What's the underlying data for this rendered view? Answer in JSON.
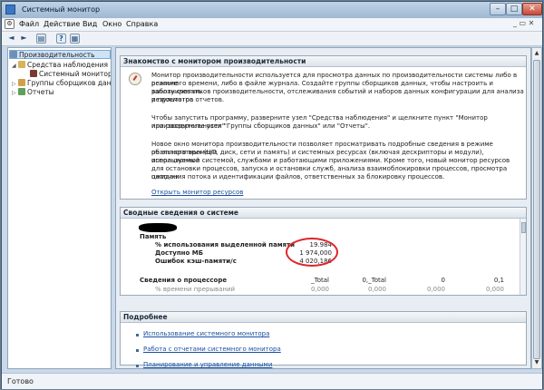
{
  "window": {
    "title": "Системный монитор"
  },
  "menu": {
    "items": [
      "Файл",
      "Действие",
      "Вид",
      "Окно",
      "Справка"
    ],
    "doc_controls": "_ ▭ ✕"
  },
  "title_controls": {
    "minimize": "–",
    "maximize": "□",
    "close": "✕"
  },
  "toolbar": {
    "back": "◄",
    "forward": "►",
    "up": "▤",
    "help": "?",
    "view": "▦"
  },
  "tree": {
    "root": "Производительность",
    "monitoring_tools": "Средства наблюдения",
    "system_monitor": "Системный монитор",
    "data_collector_sets": "Группы сборщиков данных",
    "reports": "Отчеты"
  },
  "overview": {
    "header": "Знакомство с монитором производительности",
    "p1": [
      "Монитор производительности используется для просмотра данных по производительности системы либо в режиме",
      "реального времени, либо в файле журнала. Создайте группы сборщиков данных, чтобы настроить и запланировать",
      "работу счетчиков производительности, отслеживания событий и наборов данных конфигурации для анализа результатов",
      "и просмотра отчетов."
    ],
    "p2": [
      "Чтобы запустить программу, разверните узел \"Средства наблюдения\" и щелкните пункт \"Монитор производительности\"",
      "или разверните узел \"Группы сборщиков данных\" или \"Отчеты\"."
    ],
    "p3": [
      "Новое окно монитора производительности позволяет просматривать подробные сведения в режиме реального времени",
      "об аппаратных (ЦП, диск, сети и память) и системных ресурсах (включая дескрипторы и модули), используемые",
      "операционной системой, службами и работающими приложениями. Кроме того, новый монитор ресурсов",
      "для остановки процессов, запуска и остановки служб, анализа взаимоблокировки процессов, просмотра цепочки",
      "ожидания потока и идентификации файлов, ответственных за блокировку процессов."
    ],
    "link": "Открыть монитор ресурсов"
  },
  "summary": {
    "header": "Сводные сведения о системе",
    "memory_label": "Память",
    "rows": [
      {
        "label": "% использования выделенной памяти",
        "value": "19.984"
      },
      {
        "label": "Доступно МБ",
        "value": "1 974,000"
      },
      {
        "label": "Ошибок кэш-памяти/с",
        "value": "4 020,186"
      }
    ],
    "processor_label": "Сведения о процессоре",
    "cols": [
      "_Total",
      "0,_Total",
      "0",
      "0,1"
    ],
    "next_row": [
      "% времени прерываний",
      "0,000",
      "0,000",
      "0,000",
      "0,000"
    ]
  },
  "details": {
    "header": "Подробнее",
    "links": [
      "Использование системного монитора",
      "Работа с отчетами системного монитора",
      "Планирование и управление данными"
    ]
  },
  "status": {
    "text": "Готово"
  },
  "colors": {
    "highlight_circle": "#e0252a",
    "link": "#1a4fa0"
  }
}
